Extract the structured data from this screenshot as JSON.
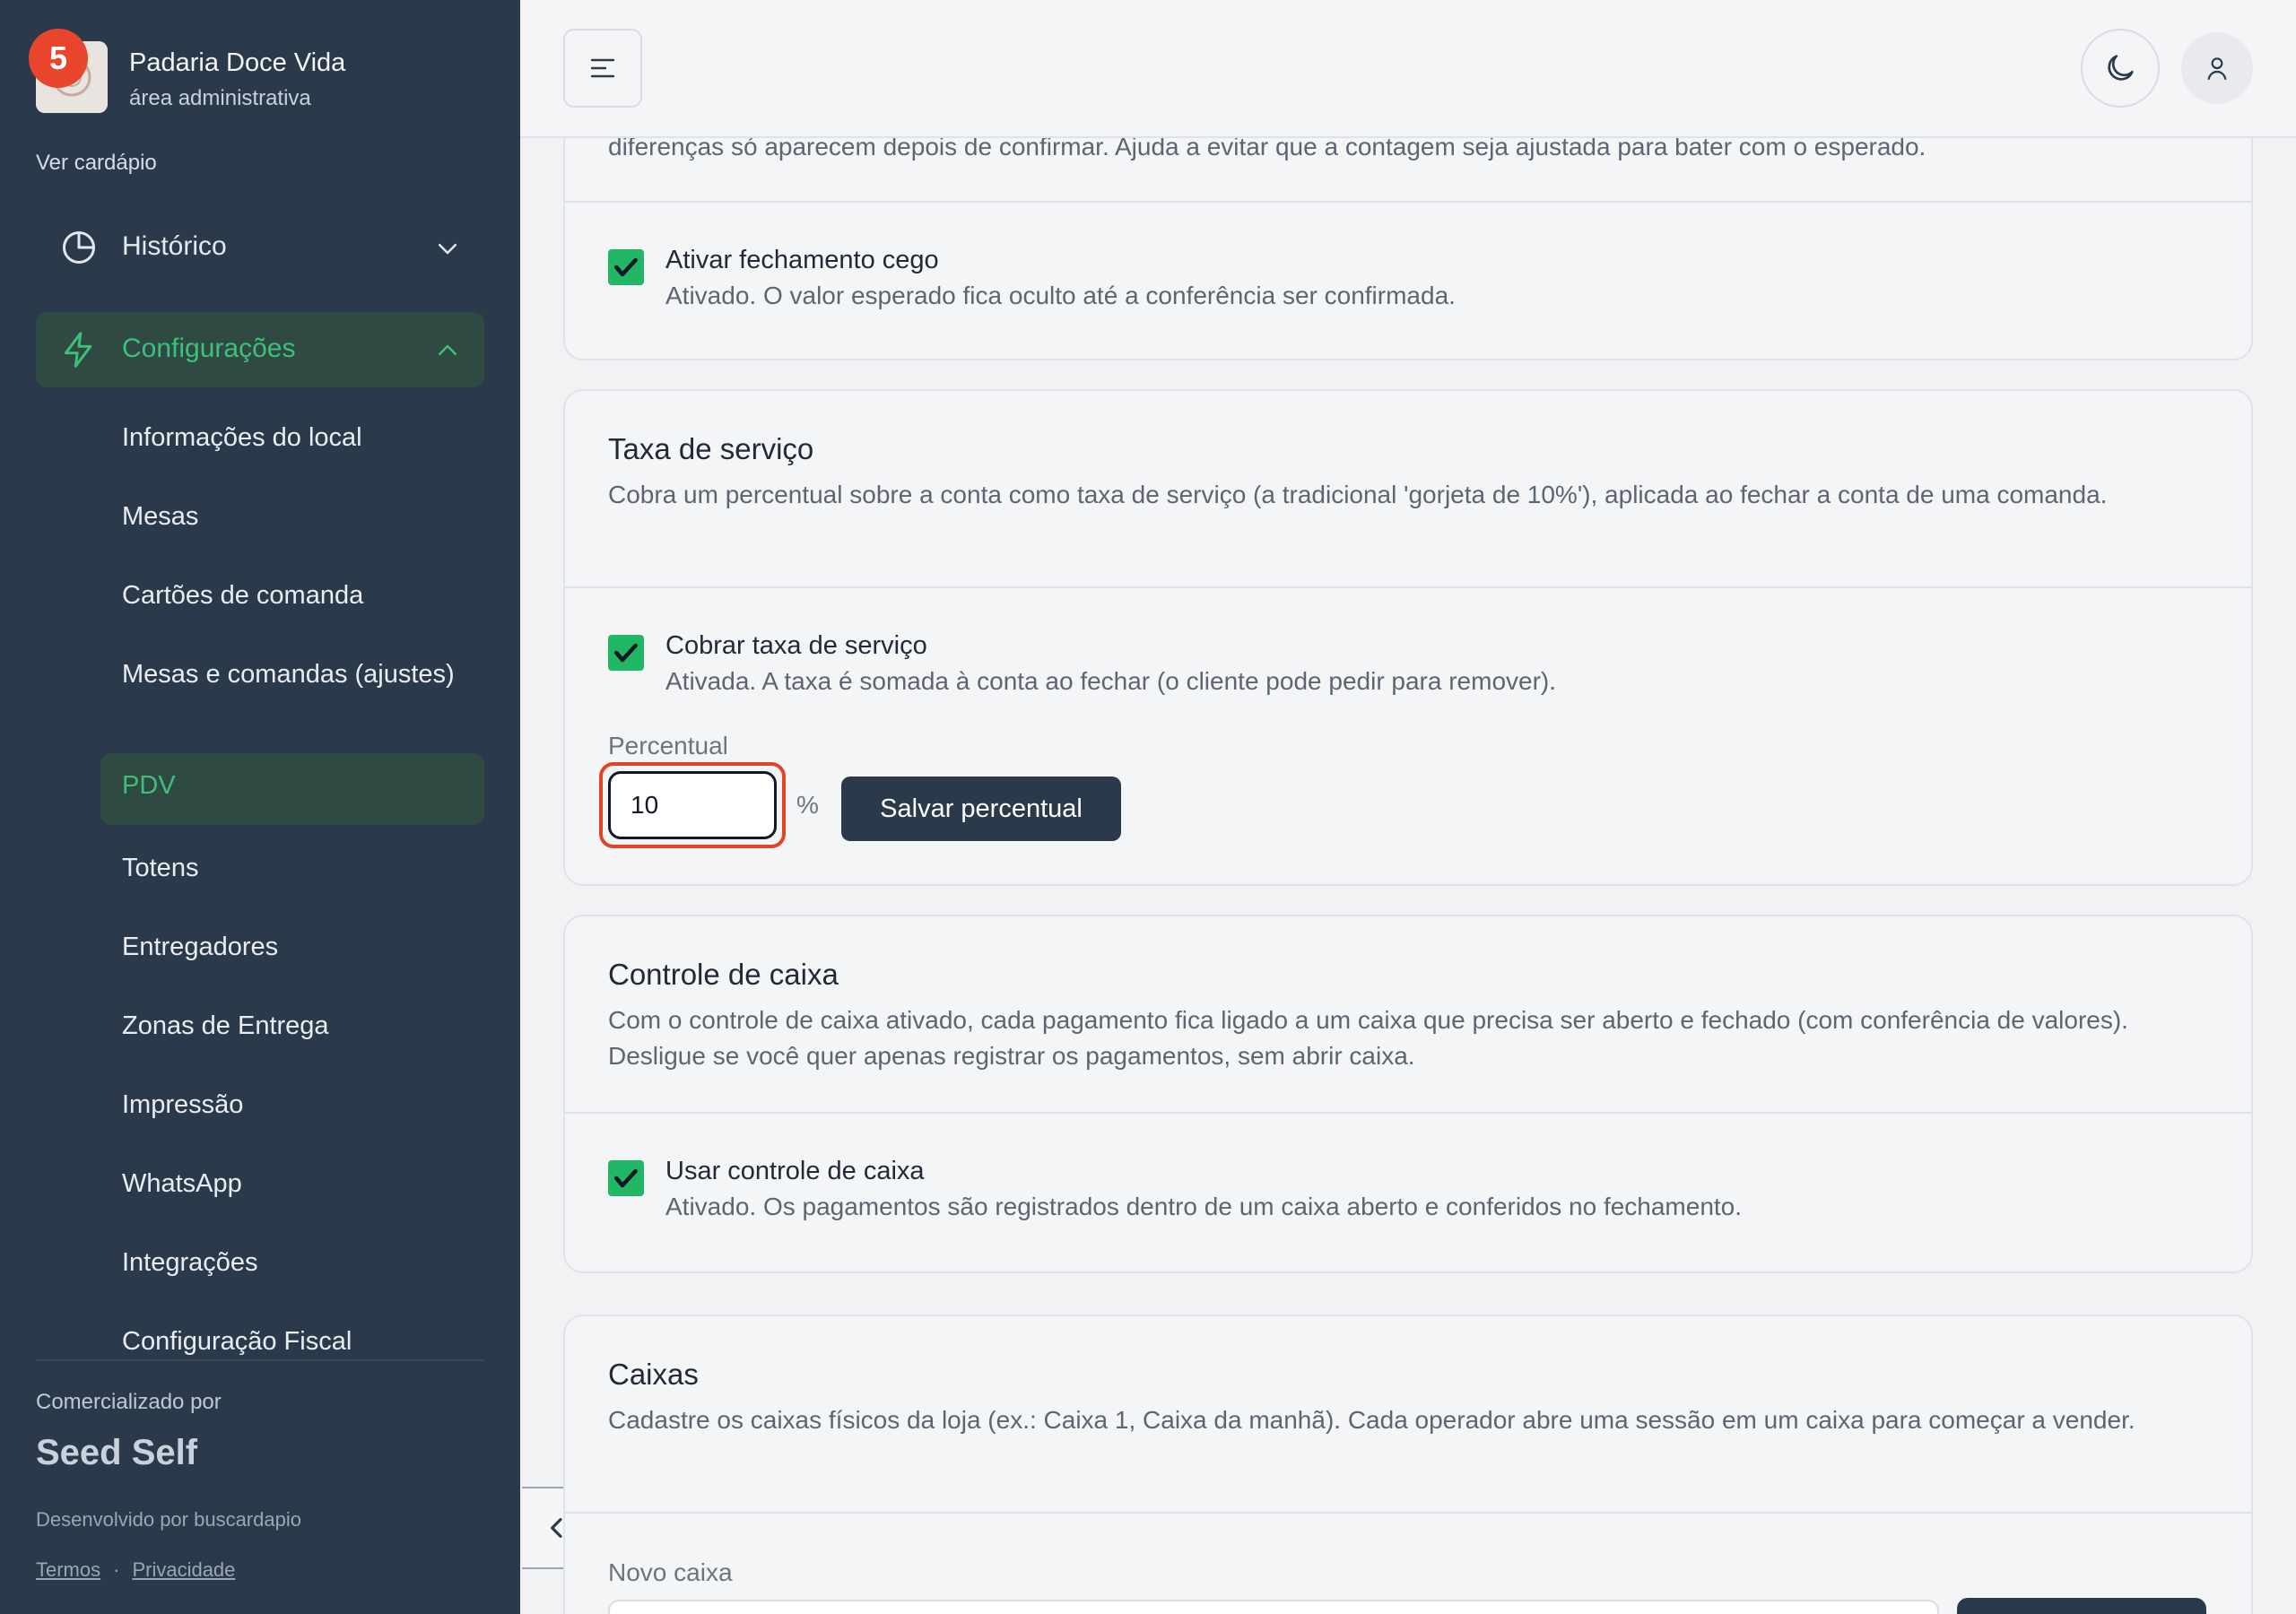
{
  "brand": {
    "name": "Padaria Doce Vida",
    "subtitle": "área administrativa",
    "badge_count": "5"
  },
  "sidebar": {
    "menu_link": "Ver cardápio",
    "groups": [
      {
        "label": "Histórico",
        "icon": "pie-chart-icon",
        "expanded": false
      },
      {
        "label": "Configurações",
        "icon": "bolt-icon",
        "expanded": true
      }
    ],
    "sub_items": [
      {
        "label": "Informações do local"
      },
      {
        "label": "Mesas"
      },
      {
        "label": "Cartões de comanda"
      },
      {
        "label": "Mesas e comandas (ajustes)"
      },
      {
        "label": "PDV",
        "active": true
      },
      {
        "label": "Totens"
      },
      {
        "label": "Entregadores"
      },
      {
        "label": "Zonas de Entrega"
      },
      {
        "label": "Impressão"
      },
      {
        "label": "WhatsApp"
      },
      {
        "label": "Integrações"
      },
      {
        "label": "Configuração Fiscal"
      }
    ],
    "footer": {
      "sold_by": "Comercializado por",
      "product": "Seed Self",
      "developed_by": "Desenvolvido por buscardapio",
      "terms": "Termos",
      "separator": "·",
      "privacy": "Privacidade"
    }
  },
  "topbar": {
    "menu_icon": "menu-icon",
    "theme_icon": "moon-icon",
    "user_icon": "user-icon"
  },
  "colors": {
    "sidebar_bg": "#2b3a4a",
    "accent_green": "#3fc07a",
    "checkbox_green": "#22b765",
    "focus_ring": "#e0452a"
  },
  "cards": {
    "blind_close": {
      "desc_tail": "diferenças só aparecem depois de confirmar. Ajuda a evitar que a contagem seja ajustada para bater com o esperado.",
      "checkbox_label": "Ativar fechamento cego",
      "checkbox_sub": "Ativado. O valor esperado fica oculto até a conferência ser confirmada.",
      "checked": true
    },
    "service_fee": {
      "title": "Taxa de serviço",
      "desc": "Cobra um percentual sobre a conta como taxa de serviço (a tradicional 'gorjeta de 10%'), aplicada ao fechar a conta de uma comanda.",
      "checkbox_label": "Cobrar taxa de serviço",
      "checkbox_sub": "Ativada. A taxa é somada à conta ao fechar (o cliente pode pedir para remover).",
      "checked": true,
      "field_label": "Percentual",
      "field_value": "10",
      "unit": "%",
      "save_label": "Salvar percentual"
    },
    "cash_control": {
      "title": "Controle de caixa",
      "desc": "Com o controle de caixa ativado, cada pagamento fica ligado a um caixa que precisa ser aberto e fechado (com conferência de valores). Desligue se você quer apenas registrar os pagamentos, sem abrir caixa.",
      "checkbox_label": "Usar controle de caixa",
      "checkbox_sub": "Ativado. Os pagamentos são registrados dentro de um caixa aberto e conferidos no fechamento.",
      "checked": true
    },
    "registers": {
      "title": "Caixas",
      "desc": "Cadastre os caixas físicos da loja (ex.: Caixa 1, Caixa da manhã). Cada operador abre uma sessão em um caixa para começar a vender.",
      "field_label": "Novo caixa"
    }
  }
}
